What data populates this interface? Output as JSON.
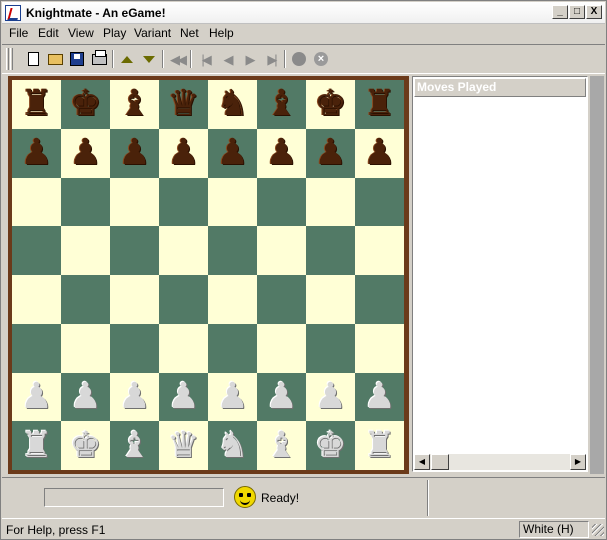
{
  "window": {
    "title": "Knightmate - An eGame!",
    "controls": [
      "_",
      "□",
      "X"
    ]
  },
  "menu": [
    "File",
    "Edit",
    "View",
    "Play",
    "Variant",
    "Net",
    "Help"
  ],
  "toolbar": {
    "icons": [
      "new-file-icon",
      "open-file-icon",
      "save-icon",
      "print-icon",
      "move-up-icon",
      "move-down-icon",
      "first-move-icon",
      "previous-move-icon",
      "back-icon",
      "forward-icon",
      "last-move-icon",
      "stop-icon",
      "cancel-icon"
    ]
  },
  "board": {
    "light_color": "#ffffd6",
    "dark_color": "#527a66",
    "frame_color": "#6b3a1a",
    "ranks": [
      [
        "b:♜",
        "b:♚",
        "b:♝",
        "b:♛",
        "b:♞",
        "b:♝",
        "b:♚",
        "b:♜"
      ],
      [
        "b:♟",
        "b:♟",
        "b:♟",
        "b:♟",
        "b:♟",
        "b:♟",
        "b:♟",
        "b:♟"
      ],
      [
        "",
        "",
        "",
        "",
        "",
        "",
        "",
        ""
      ],
      [
        "",
        "",
        "",
        "",
        "",
        "",
        "",
        ""
      ],
      [
        "",
        "",
        "",
        "",
        "",
        "",
        "",
        ""
      ],
      [
        "",
        "",
        "",
        "",
        "",
        "",
        "",
        ""
      ],
      [
        "w:♟",
        "w:♟",
        "w:♟",
        "w:♟",
        "w:♟",
        "w:♟",
        "w:♟",
        "w:♟"
      ],
      [
        "w:♜",
        "w:♚",
        "w:♝",
        "w:♛",
        "w:♞",
        "w:♝",
        "w:♚",
        "w:♜"
      ]
    ]
  },
  "moves_panel": {
    "header": "Moves Played",
    "moves": []
  },
  "status": {
    "message": "Ready!",
    "help": "For Help, press F1",
    "side": "White (H)"
  }
}
